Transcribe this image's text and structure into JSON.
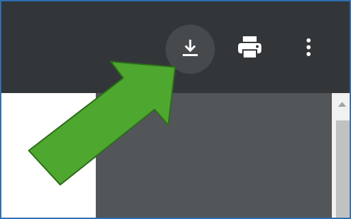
{
  "toolbar": {
    "buttons": [
      {
        "icon": "download-icon"
      },
      {
        "icon": "printer-icon"
      },
      {
        "icon": "more-vertical-icon"
      }
    ]
  },
  "annotation": {
    "icon": "green-arrow-icon",
    "color": "#4ea72e",
    "points_to": "download-button"
  },
  "colors": {
    "toolbar": "#323639",
    "viewer_background": "#525659",
    "download_highlight": "#474a4d",
    "scrollbar_track": "#f1f1f1",
    "scrollbar_thumb": "#c1c1c1",
    "frame_border": "#2f6fb3"
  }
}
